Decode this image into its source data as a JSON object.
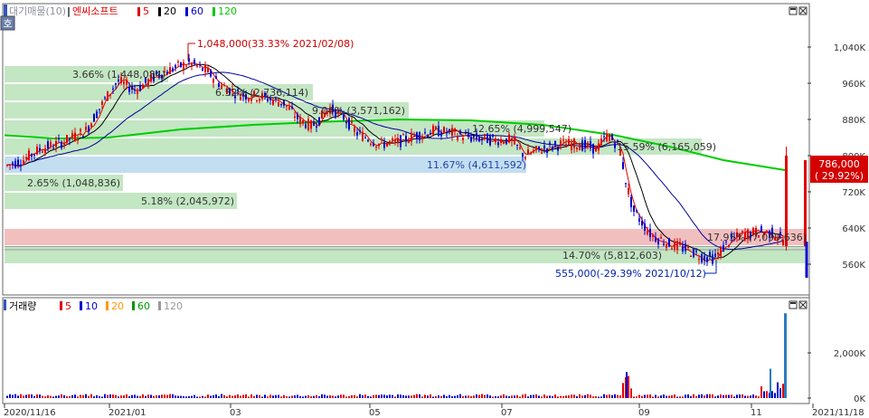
{
  "header": {
    "stock_badge": "호",
    "price_title": "대기매물(10)",
    "stock_name": "엔씨소프트",
    "ma_labels": [
      {
        "label": "5",
        "color": "#e00000"
      },
      {
        "label": "20",
        "color": "#000000"
      },
      {
        "label": "60",
        "color": "#0000cc"
      },
      {
        "label": "120",
        "color": "#00cc00"
      }
    ],
    "volume_title": "거래량",
    "volume_ma_labels": [
      {
        "label": "5",
        "color": "#e00000"
      },
      {
        "label": "10",
        "color": "#0000cc"
      },
      {
        "label": "20",
        "color": "#ff9900"
      },
      {
        "label": "60",
        "color": "#009900"
      },
      {
        "label": "120",
        "color": "#999999"
      }
    ]
  },
  "colors": {
    "up": "#e00000",
    "down": "#0000cc",
    "ma5": "#e00000",
    "ma20": "#000000",
    "ma60": "#000099",
    "ma120": "#00cc00",
    "zone_green": "#b9e2b9",
    "zone_blue": "#b8d8ee",
    "zone_red": "#f0b4b4"
  },
  "chart_data": [
    {
      "type": "candlestick",
      "title": "엔씨소프트",
      "x_labels": [
        "2020/11/16",
        "2021/01",
        "03",
        "05",
        "07",
        "09",
        "11",
        "2021/11/18"
      ],
      "y_ticks": [
        "1,040K",
        "960K",
        "880K",
        "800K",
        "720K",
        "640K",
        "560K"
      ],
      "y_tick_values": [
        1040000,
        960000,
        880000,
        800000,
        720000,
        640000,
        560000
      ],
      "ylim": [
        530000,
        1080000
      ],
      "grid": false,
      "current_price_label": "786,000",
      "current_change_label": "( 29.92%)",
      "annotations": [
        {
          "text": "1,048,000(33.33% 2021/02/08)",
          "price": 1048000,
          "kind": "high"
        },
        {
          "text": "555,000(-29.39% 2021/10/12)",
          "price": 555000,
          "kind": "low"
        }
      ],
      "supply_zones": [
        {
          "label": "3.66% (1,448,084)",
          "low": 960000,
          "high": 1000000,
          "color": "green"
        },
        {
          "label": "6.52% (2,736,114)",
          "low": 920000,
          "high": 960000,
          "color": "green"
        },
        {
          "label": "9.04% (3,571,162)",
          "low": 880000,
          "high": 920000,
          "color": "green"
        },
        {
          "label": "12.65% (4,999,547)",
          "low": 840000,
          "high": 880000,
          "color": "green"
        },
        {
          "label": "15.59% (6,165,059)",
          "low": 800000,
          "high": 840000,
          "color": "green"
        },
        {
          "label": "11.67% (4,611,592)",
          "low": 760000,
          "high": 800000,
          "color": "blue"
        },
        {
          "label": "2.65% (1,048,836)",
          "low": 720000,
          "high": 760000,
          "color": "green"
        },
        {
          "label": "5.18% (2,045,972)",
          "low": 680000,
          "high": 720000,
          "color": "green"
        },
        {
          "label": "17.95% (7,099,636)",
          "low": 600000,
          "high": 640000,
          "color": "red"
        },
        {
          "label": "14.70% (5,812,603)",
          "low": 560000,
          "high": 600000,
          "color": "green"
        }
      ],
      "series": [
        {
          "name": "5",
          "kind": "ma"
        },
        {
          "name": "20",
          "kind": "ma"
        },
        {
          "name": "60",
          "kind": "ma"
        },
        {
          "name": "120",
          "kind": "ma"
        }
      ]
    },
    {
      "type": "bar",
      "title": "거래량",
      "y_ticks": [
        "2,000K",
        "0K"
      ],
      "y_tick_values": [
        2000000,
        0
      ],
      "ylim": [
        0,
        4000000
      ],
      "note": "daily volume bars; spike near 2021/11 of about 3,750K"
    }
  ]
}
